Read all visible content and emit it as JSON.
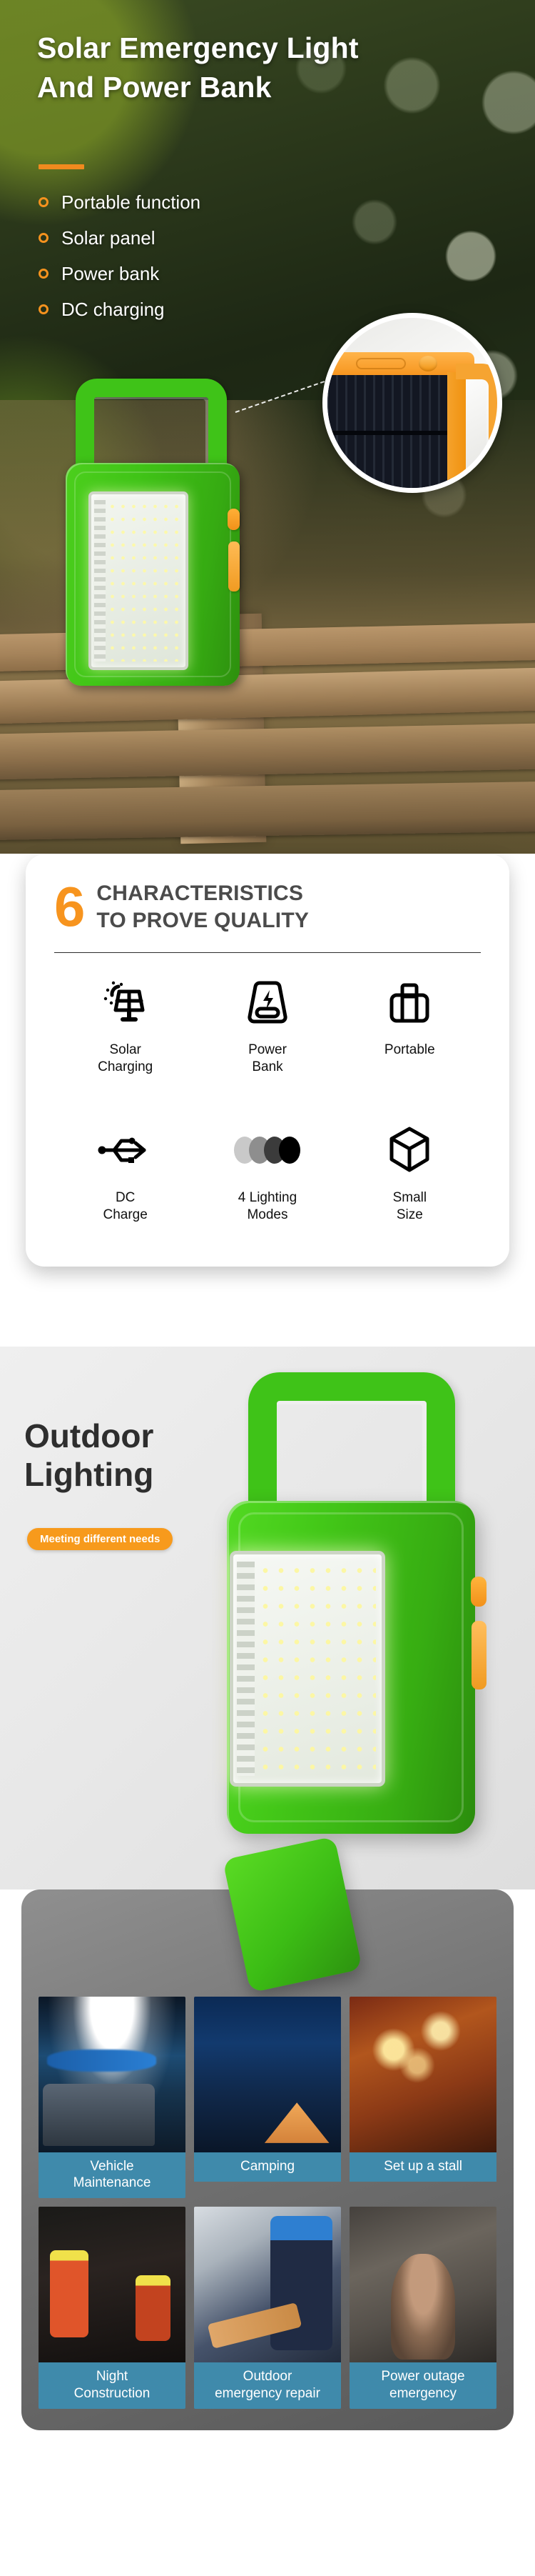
{
  "hero": {
    "title_line1": "Solar Emergency Light",
    "title_line2": "And Power Bank",
    "accent_color": "#f08a1e",
    "bullets": [
      "Portable function",
      "Solar panel",
      "Power bank",
      "DC charging"
    ]
  },
  "characteristics": {
    "number": "6",
    "title_line1": "CHARACTERISTICS",
    "title_line2": "TO PROVE QUALITY",
    "number_color": "#f7941e",
    "items": [
      {
        "icon": "solar-panel-icon",
        "label": "Solar\nCharging"
      },
      {
        "icon": "power-bank-icon",
        "label": "Power\nBank"
      },
      {
        "icon": "briefcase-icon",
        "label": "Portable"
      },
      {
        "icon": "usb-icon",
        "label": "DC\nCharge"
      },
      {
        "icon": "lighting-modes-icon",
        "label": "4 Lighting\nModes"
      },
      {
        "icon": "cube-icon",
        "label": "Small\nSize"
      }
    ],
    "mode_dot_colors": [
      "#c9c9c9",
      "#8e8e8e",
      "#3b3b3b",
      "#000000"
    ]
  },
  "outdoor": {
    "title_line1": "Outdoor",
    "title_line2": "Lighting",
    "badge": "Meeting different needs",
    "badge_color": "#f79a1c"
  },
  "scenarios": {
    "caption_color": "#3f8aab",
    "items": [
      {
        "art": "s-vehicle",
        "caption": "Vehicle\nMaintenance"
      },
      {
        "art": "s-camp",
        "caption": "Camping"
      },
      {
        "art": "s-stall",
        "caption": "Set up a stall"
      },
      {
        "art": "s-night",
        "caption": "Night\nConstruction"
      },
      {
        "art": "s-repair",
        "caption": "Outdoor\nemergency repair"
      },
      {
        "art": "s-outage",
        "caption": "Power outage\nemergency"
      }
    ]
  }
}
